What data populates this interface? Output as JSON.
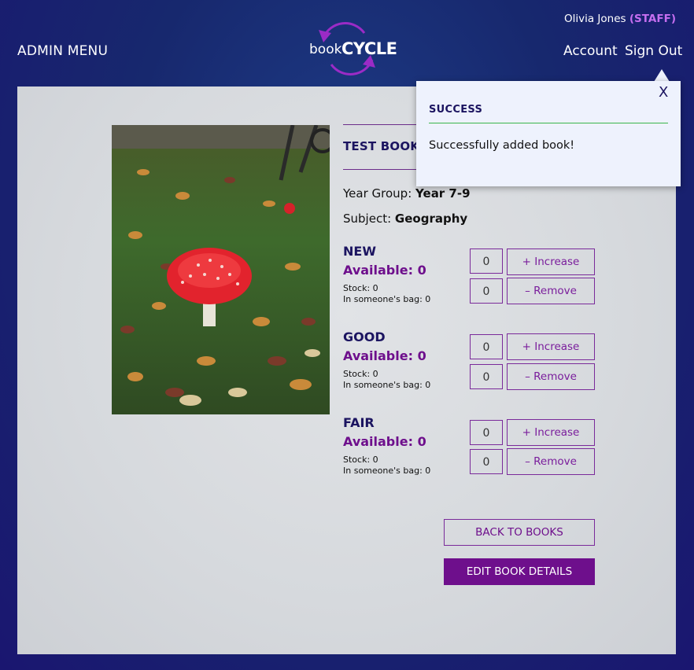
{
  "header": {
    "admin_menu": "ADMIN MENU",
    "user_name": "Olivia Jones",
    "user_role": "(STAFF)",
    "nav": {
      "account": "Account",
      "sign_out": "Sign Out"
    },
    "logo": {
      "word1": "book",
      "word2": "CYCLE"
    }
  },
  "book": {
    "title": "TEST BOOK",
    "year_group_label": "Year Group:",
    "year_group_value": "Year 7-9",
    "subject_label": "Subject:",
    "subject_value": "Geography",
    "conditions": [
      {
        "name": "NEW",
        "available": "Available: 0",
        "stock": "Stock: 0",
        "bag": "In someone's bag: 0",
        "increase_qty": "0",
        "remove_qty": "0",
        "increase_label": "+ Increase",
        "remove_label": "– Remove"
      },
      {
        "name": "GOOD",
        "available": "Available: 0",
        "stock": "Stock: 0",
        "bag": "In someone's bag: 0",
        "increase_qty": "0",
        "remove_qty": "0",
        "increase_label": "+ Increase",
        "remove_label": "– Remove"
      },
      {
        "name": "FAIR",
        "available": "Available: 0",
        "stock": "Stock: 0",
        "bag": "In someone's bag: 0",
        "increase_qty": "0",
        "remove_qty": "0",
        "increase_label": "+ Increase",
        "remove_label": "– Remove"
      }
    ]
  },
  "actions": {
    "back": "BACK TO BOOKS",
    "edit": "EDIT BOOK DETAILS"
  },
  "toast": {
    "close": "X",
    "title": "SUCCESS",
    "message": "Successfully added book!"
  },
  "colors": {
    "accent": "#6e0f8c",
    "navy": "#1b1460",
    "success_line": "#3ab54a",
    "role": "#c56ef0"
  }
}
